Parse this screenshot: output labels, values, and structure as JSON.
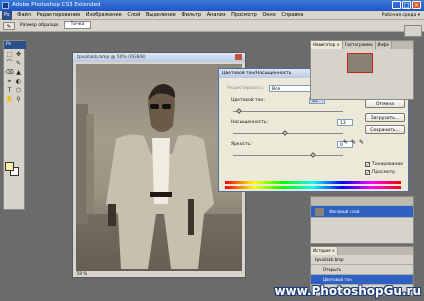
{
  "window": {
    "title": "Adobe Photoshop CS3 Extended"
  },
  "menu": {
    "ps_badge": "Ps",
    "items": [
      "Файл",
      "Редактирование",
      "Изображение",
      "Слой",
      "Выделение",
      "Фильтр",
      "Анализ",
      "Просмотр",
      "Окно",
      "Справка"
    ],
    "workspace_label": "Рабочая среда ▾"
  },
  "options_bar": {
    "sample_label": "Размер образца:",
    "sample_value": "Точка"
  },
  "toolbox": {
    "header": "Ps",
    "tools": [
      "⬚",
      "✥",
      "⌒",
      "✎",
      "⌫",
      "▲",
      "⌖",
      "◐",
      "T",
      "⬡",
      "✋",
      "⚲"
    ]
  },
  "document": {
    "title": "tpvoilakb.bmp @ 50% (RGB/8)",
    "zoom": "50 %"
  },
  "dialog": {
    "title": "Цветовой тон/Насыщенность",
    "edit_label": "Редактировать:",
    "edit_value": "Все",
    "hue_label": "Цветовой тон:",
    "hue_value": "35",
    "saturation_label": "Насыщенность:",
    "saturation_value": "13",
    "lightness_label": "Яркость:",
    "lightness_value": "0",
    "ok": "Да",
    "cancel": "Отмена",
    "load": "Загрузить...",
    "save": "Сохранить...",
    "colorize": "Тонирование",
    "preview": "Просмотр",
    "hue_level": 0.5,
    "saturation_level": 0.13,
    "lightness_level": 0.5
  },
  "navigator": {
    "tabs": [
      "Навигатор ×",
      "Гистограмма",
      "Инфо"
    ]
  },
  "layers": {
    "active_layer": "Фоновый слой"
  },
  "history": {
    "tab": "История ×",
    "snapshot": "tpvoilakb.bmp",
    "items": [
      "Открыть",
      "Цветовой тон"
    ]
  },
  "watermark": "www.PhotoshopGu.ru"
}
